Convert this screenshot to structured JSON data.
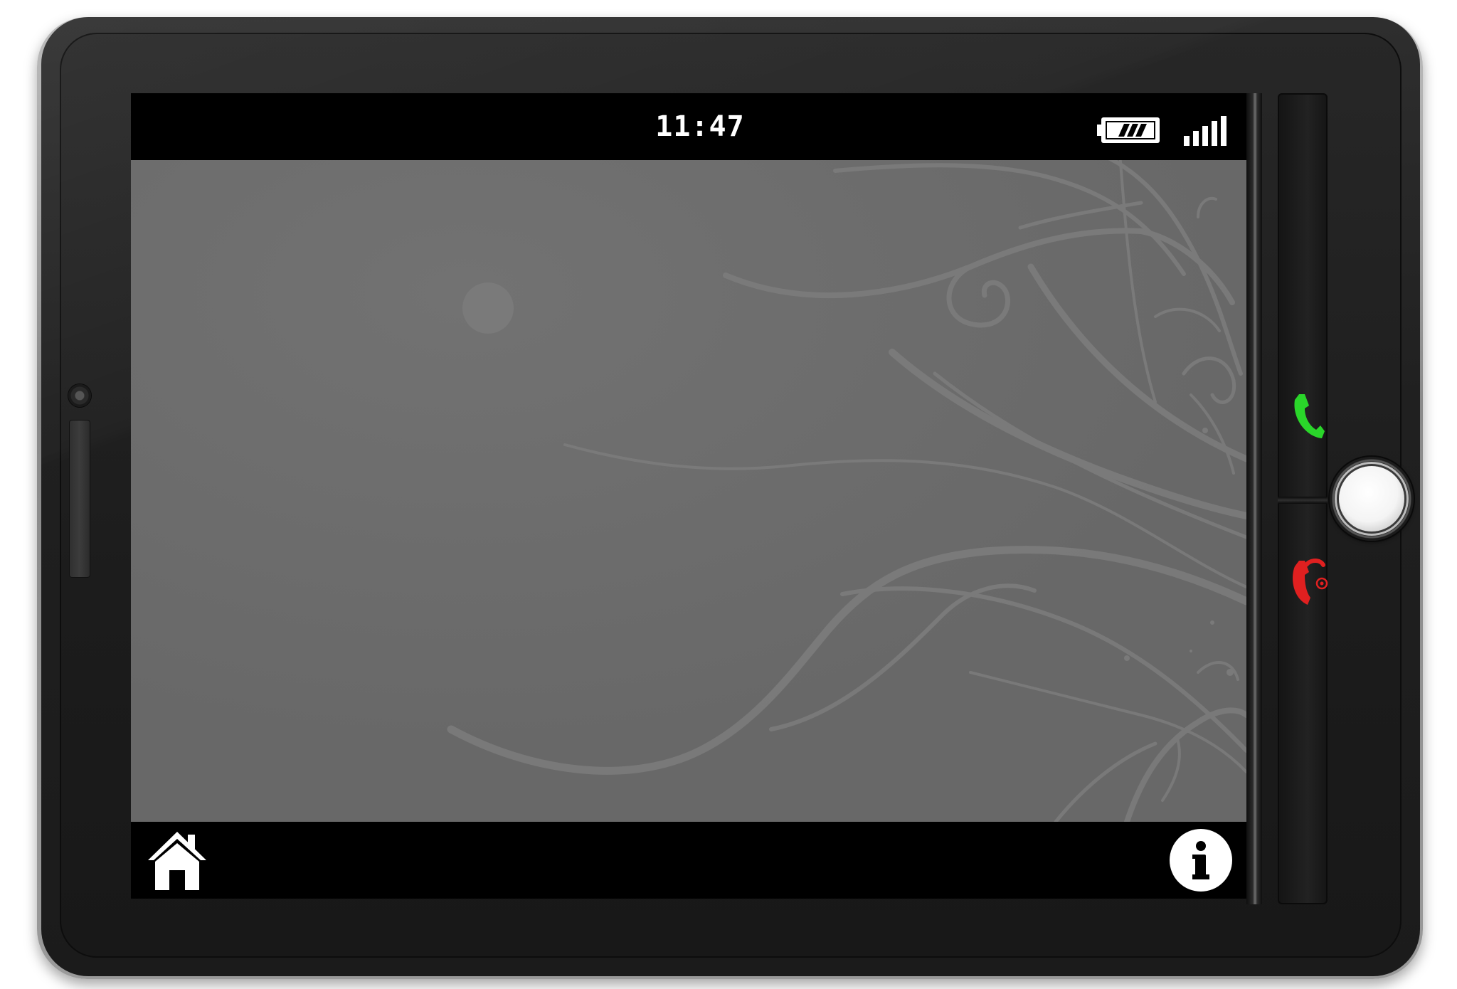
{
  "status_bar": {
    "time": "11:47",
    "battery_icon": "battery-icon",
    "battery_level": 0.75,
    "signal_icon": "signal-strength-icon",
    "signal_bars": 5
  },
  "wallpaper": {
    "background_color": "#6b6b6b",
    "swirl_color": "#7c7c7c"
  },
  "bottom_bar": {
    "home_icon": "home-icon",
    "info_icon": "info-icon"
  },
  "hardware_keys": {
    "call_icon": "call-icon",
    "call_color": "#2ad62a",
    "end_call_icon": "end-call-icon",
    "end_call_color": "#e02020",
    "center_key_icon": "center-key"
  }
}
